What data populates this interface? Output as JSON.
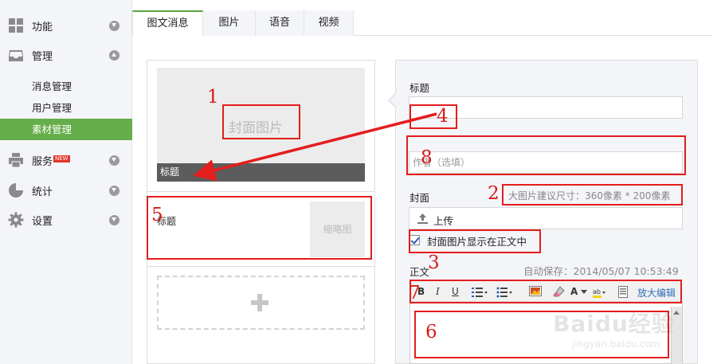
{
  "sidebar": {
    "items": [
      {
        "label": "功能",
        "icon": "grid-icon",
        "state": "collapsed"
      },
      {
        "label": "管理",
        "icon": "inbox-icon",
        "state": "expanded"
      },
      {
        "label": "服务",
        "icon": "printer-icon",
        "state": "collapsed",
        "badge": "NEW"
      },
      {
        "label": "统计",
        "icon": "pie-chart-icon",
        "state": "collapsed"
      },
      {
        "label": "设置",
        "icon": "gear-icon",
        "state": "collapsed"
      }
    ],
    "subitems": [
      {
        "label": "消息管理",
        "active": false
      },
      {
        "label": "用户管理",
        "active": false
      },
      {
        "label": "素材管理",
        "active": true
      }
    ]
  },
  "tabs": [
    {
      "label": "图文消息",
      "active": true
    },
    {
      "label": "图片",
      "active": false
    },
    {
      "label": "语音",
      "active": false
    },
    {
      "label": "视频",
      "active": false
    }
  ],
  "preview": {
    "cover_text": "封面图片",
    "cover_title": "标题",
    "item2_title": "标题",
    "thumb_text": "缩略图"
  },
  "form": {
    "title_label": "标题",
    "author_placeholder": "作者（选填）",
    "cover_label": "封面",
    "cover_hint": "大图片建议尺寸：360像素 * 200像素",
    "upload_label": "上传",
    "show_cover_label": "封面图片显示在正文中",
    "show_cover_checked": true,
    "body_label": "正文",
    "autosave": "自动保存：2014/05/07 10:53:49",
    "toolbar": {
      "bold": "B",
      "italic": "I",
      "underline": "U",
      "font_color": "A",
      "expand": "放大编辑"
    }
  },
  "annotations": {
    "n1": "1",
    "n2": "2",
    "n3": "3",
    "n4": "4",
    "n5": "5",
    "n6": "6",
    "n7": "7",
    "n8": "8",
    "color": "#e41d1d"
  },
  "watermark": {
    "text": "Baidu经验",
    "sub": "jingyan.baidu.com"
  },
  "colors": {
    "active_green": "#66ad4b",
    "tab_accent": "#55a33e",
    "link_blue": "#2c6fb6"
  }
}
